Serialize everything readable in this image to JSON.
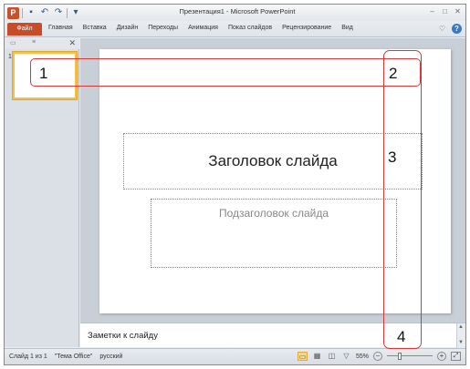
{
  "titlebar": {
    "title": "Презентация1 - Microsoft PowerPoint",
    "logo_letter": "P",
    "qat_icons": [
      "save-icon",
      "undo-icon",
      "redo-icon",
      "customize-qat-icon"
    ]
  },
  "ribbon": {
    "file_tab": "Файл",
    "tabs": [
      "Главная",
      "Вставка",
      "Дизайн",
      "Переходы",
      "Анимация",
      "Показ слайдов",
      "Рецензирование",
      "Вид"
    ]
  },
  "slide_panel": {
    "thumb_number": "1"
  },
  "slide": {
    "title_placeholder": "Заголовок слайда",
    "subtitle_placeholder": "Подзаголовок слайда"
  },
  "notes": {
    "placeholder": "Заметки к слайду"
  },
  "statusbar": {
    "slide_info": "Слайд 1 из 1",
    "theme": "\"Тема Office\"",
    "language": "русский",
    "zoom": "55%",
    "zoom_level_percent": 55
  },
  "callouts": {
    "c1": "1",
    "c2": "2",
    "c3": "3",
    "c4": "4",
    "color": "#d23a3a"
  },
  "colors": {
    "file_tab": "#c74d2a",
    "thumb_border": "#f3c04a"
  }
}
